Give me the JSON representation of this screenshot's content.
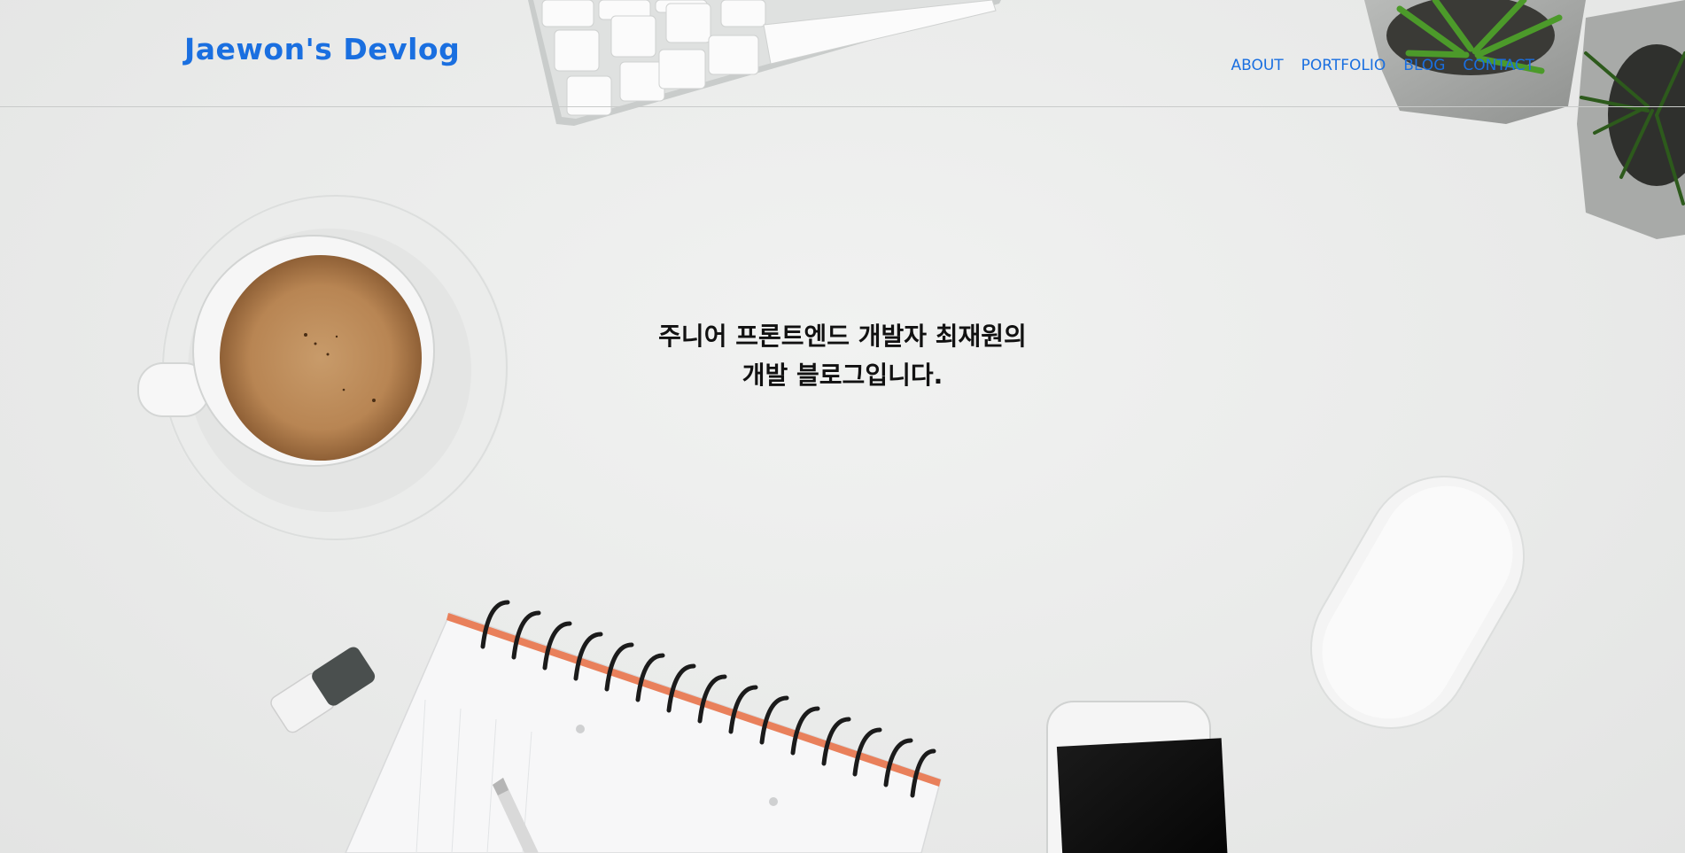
{
  "header": {
    "logo": "Jaewon's Devlog",
    "nav": [
      {
        "label": "ABOUT"
      },
      {
        "label": "PORTFOLIO"
      },
      {
        "label": "BLOG"
      },
      {
        "label": "CONTACT"
      }
    ]
  },
  "hero": {
    "line1": "주니어 프론트엔드 개발자 최재원의",
    "line2": "개발 블로그입니다."
  },
  "colors": {
    "accent": "#1a6fe0",
    "background": "#eceded",
    "text": "#111111"
  }
}
